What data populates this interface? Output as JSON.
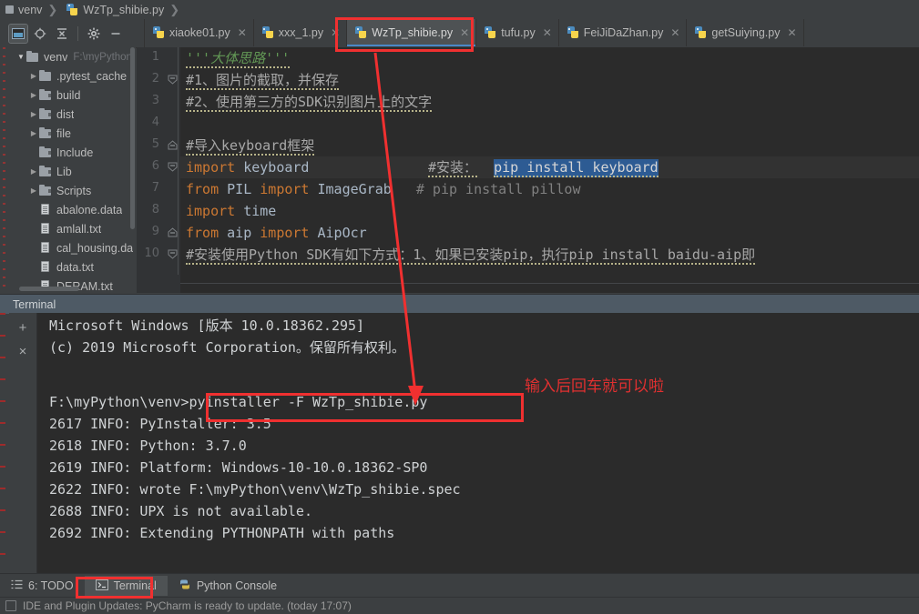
{
  "window": {
    "breadcrumb": [
      {
        "label": "venv",
        "icon": "folder-icon"
      },
      {
        "label": "WzTp_shibie.py",
        "icon": "python-file-icon"
      }
    ]
  },
  "toolbar": {
    "buttons": [
      {
        "name": "project-view-icon",
        "tooltip": "Project"
      },
      {
        "name": "locate-file-icon",
        "tooltip": "Select Opened File"
      },
      {
        "name": "collapse-all-icon",
        "tooltip": "Collapse All"
      },
      {
        "name": "gear-icon",
        "tooltip": "Settings"
      },
      {
        "name": "hide-icon",
        "tooltip": "Hide"
      }
    ]
  },
  "tabs": [
    {
      "label": "xiaoke01.py",
      "active": false
    },
    {
      "label": "xxx_1.py",
      "active": false
    },
    {
      "label": "WzTp_shibie.py",
      "active": true
    },
    {
      "label": "tufu.py",
      "active": false
    },
    {
      "label": "FeiJiDaZhan.py",
      "active": false
    },
    {
      "label": "getSuiying.py",
      "active": false
    }
  ],
  "project_tree": [
    {
      "label": "venv",
      "path": "F:\\myPython",
      "type": "folder",
      "expanded": true,
      "indent": 0
    },
    {
      "label": ".pytest_cache",
      "type": "folder",
      "expanded": false,
      "indent": 1
    },
    {
      "label": "build",
      "type": "folder",
      "expanded": false,
      "indent": 1
    },
    {
      "label": "dist",
      "type": "folder",
      "expanded": false,
      "indent": 1
    },
    {
      "label": "file",
      "type": "folder",
      "expanded": false,
      "indent": 1
    },
    {
      "label": "Include",
      "type": "folder",
      "expanded": null,
      "indent": 1
    },
    {
      "label": "Lib",
      "type": "folder",
      "expanded": false,
      "indent": 1
    },
    {
      "label": "Scripts",
      "type": "folder",
      "expanded": false,
      "indent": 1
    },
    {
      "label": "abalone.data",
      "type": "file",
      "indent": 1
    },
    {
      "label": "amlall.txt",
      "type": "file",
      "indent": 1
    },
    {
      "label": "cal_housing.da",
      "type": "file",
      "indent": 1
    },
    {
      "label": "data.txt",
      "type": "file",
      "indent": 1
    },
    {
      "label": "DERAM.txt",
      "type": "file",
      "indent": 1
    }
  ],
  "editor": {
    "line_numbers": [
      "1",
      "2",
      "3",
      "4",
      "5",
      "6",
      "7",
      "8",
      "9",
      "10"
    ],
    "lines": [
      {
        "n": "1",
        "fold": false,
        "segments": [
          {
            "t": "'''大体思路'''",
            "c": "str",
            "squiggle": true
          }
        ]
      },
      {
        "n": "2",
        "fold": true,
        "segments": [
          {
            "t": "#1、图片的截取，并保存",
            "c": "cmt-cn",
            "squiggle": true
          }
        ]
      },
      {
        "n": "3",
        "fold": false,
        "segments": [
          {
            "t": "#2、使用第三方的SDK识别图片上的文字",
            "c": "cmt-cn",
            "squiggle": true
          }
        ]
      },
      {
        "n": "4",
        "fold": false,
        "segments": []
      },
      {
        "n": "5",
        "fold": true,
        "segments": [
          {
            "t": "#导入keyboard框架",
            "c": "cmt-cn",
            "squiggle": true
          }
        ]
      },
      {
        "n": "6",
        "fold": true,
        "segments": [
          {
            "t": "import",
            "c": "kw"
          },
          {
            "t": " keyboard",
            "c": "id"
          }
        ]
      },
      {
        "n": "7",
        "fold": false,
        "segments": [
          {
            "t": "from",
            "c": "kw"
          },
          {
            "t": " PIL ",
            "c": "id"
          },
          {
            "t": "import",
            "c": "kw"
          },
          {
            "t": " ImageGrab",
            "c": "id"
          }
        ]
      },
      {
        "n": "8",
        "fold": false,
        "segments": [
          {
            "t": "import",
            "c": "kw"
          },
          {
            "t": " time",
            "c": "id"
          }
        ]
      },
      {
        "n": "9",
        "fold": true,
        "segments": [
          {
            "t": "from",
            "c": "kw"
          },
          {
            "t": " aip ",
            "c": "id"
          },
          {
            "t": "import",
            "c": "kw"
          },
          {
            "t": " AipOcr",
            "c": "id"
          }
        ]
      },
      {
        "n": "10",
        "fold": true,
        "segments": [
          {
            "t": "#安装使用Python SDK有如下方式：1、如果已安装pip，执行pip install baidu-aip即",
            "c": "cmt-cn",
            "squiggle": true
          }
        ]
      }
    ],
    "line6_comment_prefix": "#安装：",
    "line6_comment_selected": "pip install keyboard",
    "line7_comment": "# pip install pillow"
  },
  "terminal": {
    "panel_title": "Terminal",
    "side_buttons": [
      {
        "name": "new-session-icon",
        "glyph": "+"
      },
      {
        "name": "close-session-icon",
        "glyph": "×"
      }
    ],
    "lines": [
      "Microsoft Windows [版本 10.0.18362.295]",
      "(c) 2019 Microsoft Corporation。保留所有权利。",
      "",
      "F:\\myPython\\venv>pyinstaller -F WzTp_shibie.py",
      "2617 INFO: PyInstaller: 3.5",
      "2618 INFO: Python: 3.7.0",
      "2619 INFO: Platform: Windows-10-10.0.18362-SP0",
      "2622 INFO: wrote F:\\myPython\\venv\\WzTp_shibie.spec",
      "2688 INFO: UPX is not available.",
      "2692 INFO: Extending PYTHONPATH with paths"
    ],
    "prompt": "F:\\myPython\\venv>",
    "command": "pyinstaller -F WzTp_shibie.py"
  },
  "bottom_bar": {
    "items": [
      {
        "label": "6: TODO",
        "icon": "todo-list-icon",
        "active": false
      },
      {
        "label": "Terminal",
        "icon": "terminal-icon",
        "active": true
      },
      {
        "label": "Python Console",
        "icon": "python-console-icon",
        "active": false
      }
    ]
  },
  "status_bar": {
    "message": "IDE and Plugin Updates: PyCharm is ready to update. (today 17:07)"
  },
  "annotations": {
    "tab_box": "highlight-rectangle-around-active-tab",
    "command_box": "highlight-rectangle-around-typed-command",
    "terminal_button_box": "highlight-rectangle-around-terminal-button",
    "note_text": "输入后回车就可以啦",
    "arrow": "red-arrow-from-tab-to-command"
  },
  "colors": {
    "accent": "#4a88c7",
    "annotation": "#f03030",
    "editor_bg": "#2b2b2b",
    "panel_bg": "#3c3f41",
    "selection": "#2d5b93",
    "string": "#629755",
    "keyword": "#cc7832"
  }
}
